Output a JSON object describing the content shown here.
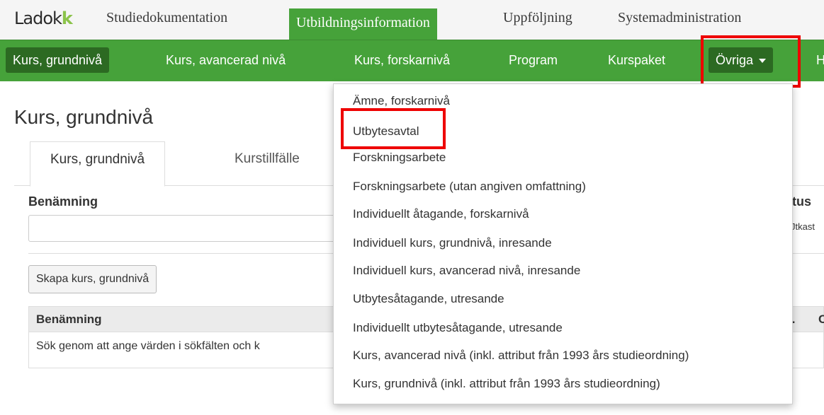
{
  "app": {
    "logo_main": "Ladok",
    "logo_accent": "k"
  },
  "top_nav": {
    "items": [
      {
        "label": "Studiedokumentation"
      },
      {
        "label": "Utbildningsinformation"
      },
      {
        "label": "Uppföljning"
      },
      {
        "label": "Systemadministration"
      }
    ],
    "active_index": 1
  },
  "sub_nav": {
    "items": [
      {
        "label": "Kurs, grundnivå"
      },
      {
        "label": "Kurs, avancerad nivå"
      },
      {
        "label": "Kurs, forskarnivå"
      },
      {
        "label": "Program"
      },
      {
        "label": "Kurspaket"
      },
      {
        "label": "Övriga"
      },
      {
        "label": "H"
      }
    ]
  },
  "page": {
    "title": "Kurs, grundnivå",
    "tabs": [
      {
        "label": "Kurs, grundnivå"
      },
      {
        "label": "Kurstillfälle"
      }
    ],
    "search": {
      "label": "Benämning",
      "value": ""
    },
    "status": {
      "label_partial": "tus",
      "value_partial": "Jtkast"
    },
    "create_button": "Skapa kurs, grundnivå",
    "table": {
      "header": "Benämning",
      "header_ellipsis": "..",
      "header_partial": "C",
      "empty_message": "Sök genom att ange värden i sökfälten och k"
    }
  },
  "dropdown": {
    "items": [
      {
        "label": "Ämne, forskarnivå"
      },
      {
        "label": "Utbytesavtal"
      },
      {
        "label": "Forskningsarbete"
      },
      {
        "label": "Forskningsarbete (utan angiven omfattning)"
      },
      {
        "label": "Individuellt åtagande, forskarnivå"
      },
      {
        "label": "Individuell kurs, grundnivå, inresande"
      },
      {
        "label": "Individuell kurs, avancerad nivå, inresande"
      },
      {
        "label": "Utbytesåtagande, utresande"
      },
      {
        "label": "Individuellt utbytesåtagande, utresande"
      },
      {
        "label": "Kurs, avancerad nivå (inkl. attribut från 1993 års studieordning)"
      },
      {
        "label": "Kurs, grundnivå (inkl. attribut från 1993 års studieordning)"
      }
    ]
  },
  "colors": {
    "brand_green": "#46a23a",
    "dark_green": "#2c6a22",
    "highlight_red": "#e00000"
  }
}
